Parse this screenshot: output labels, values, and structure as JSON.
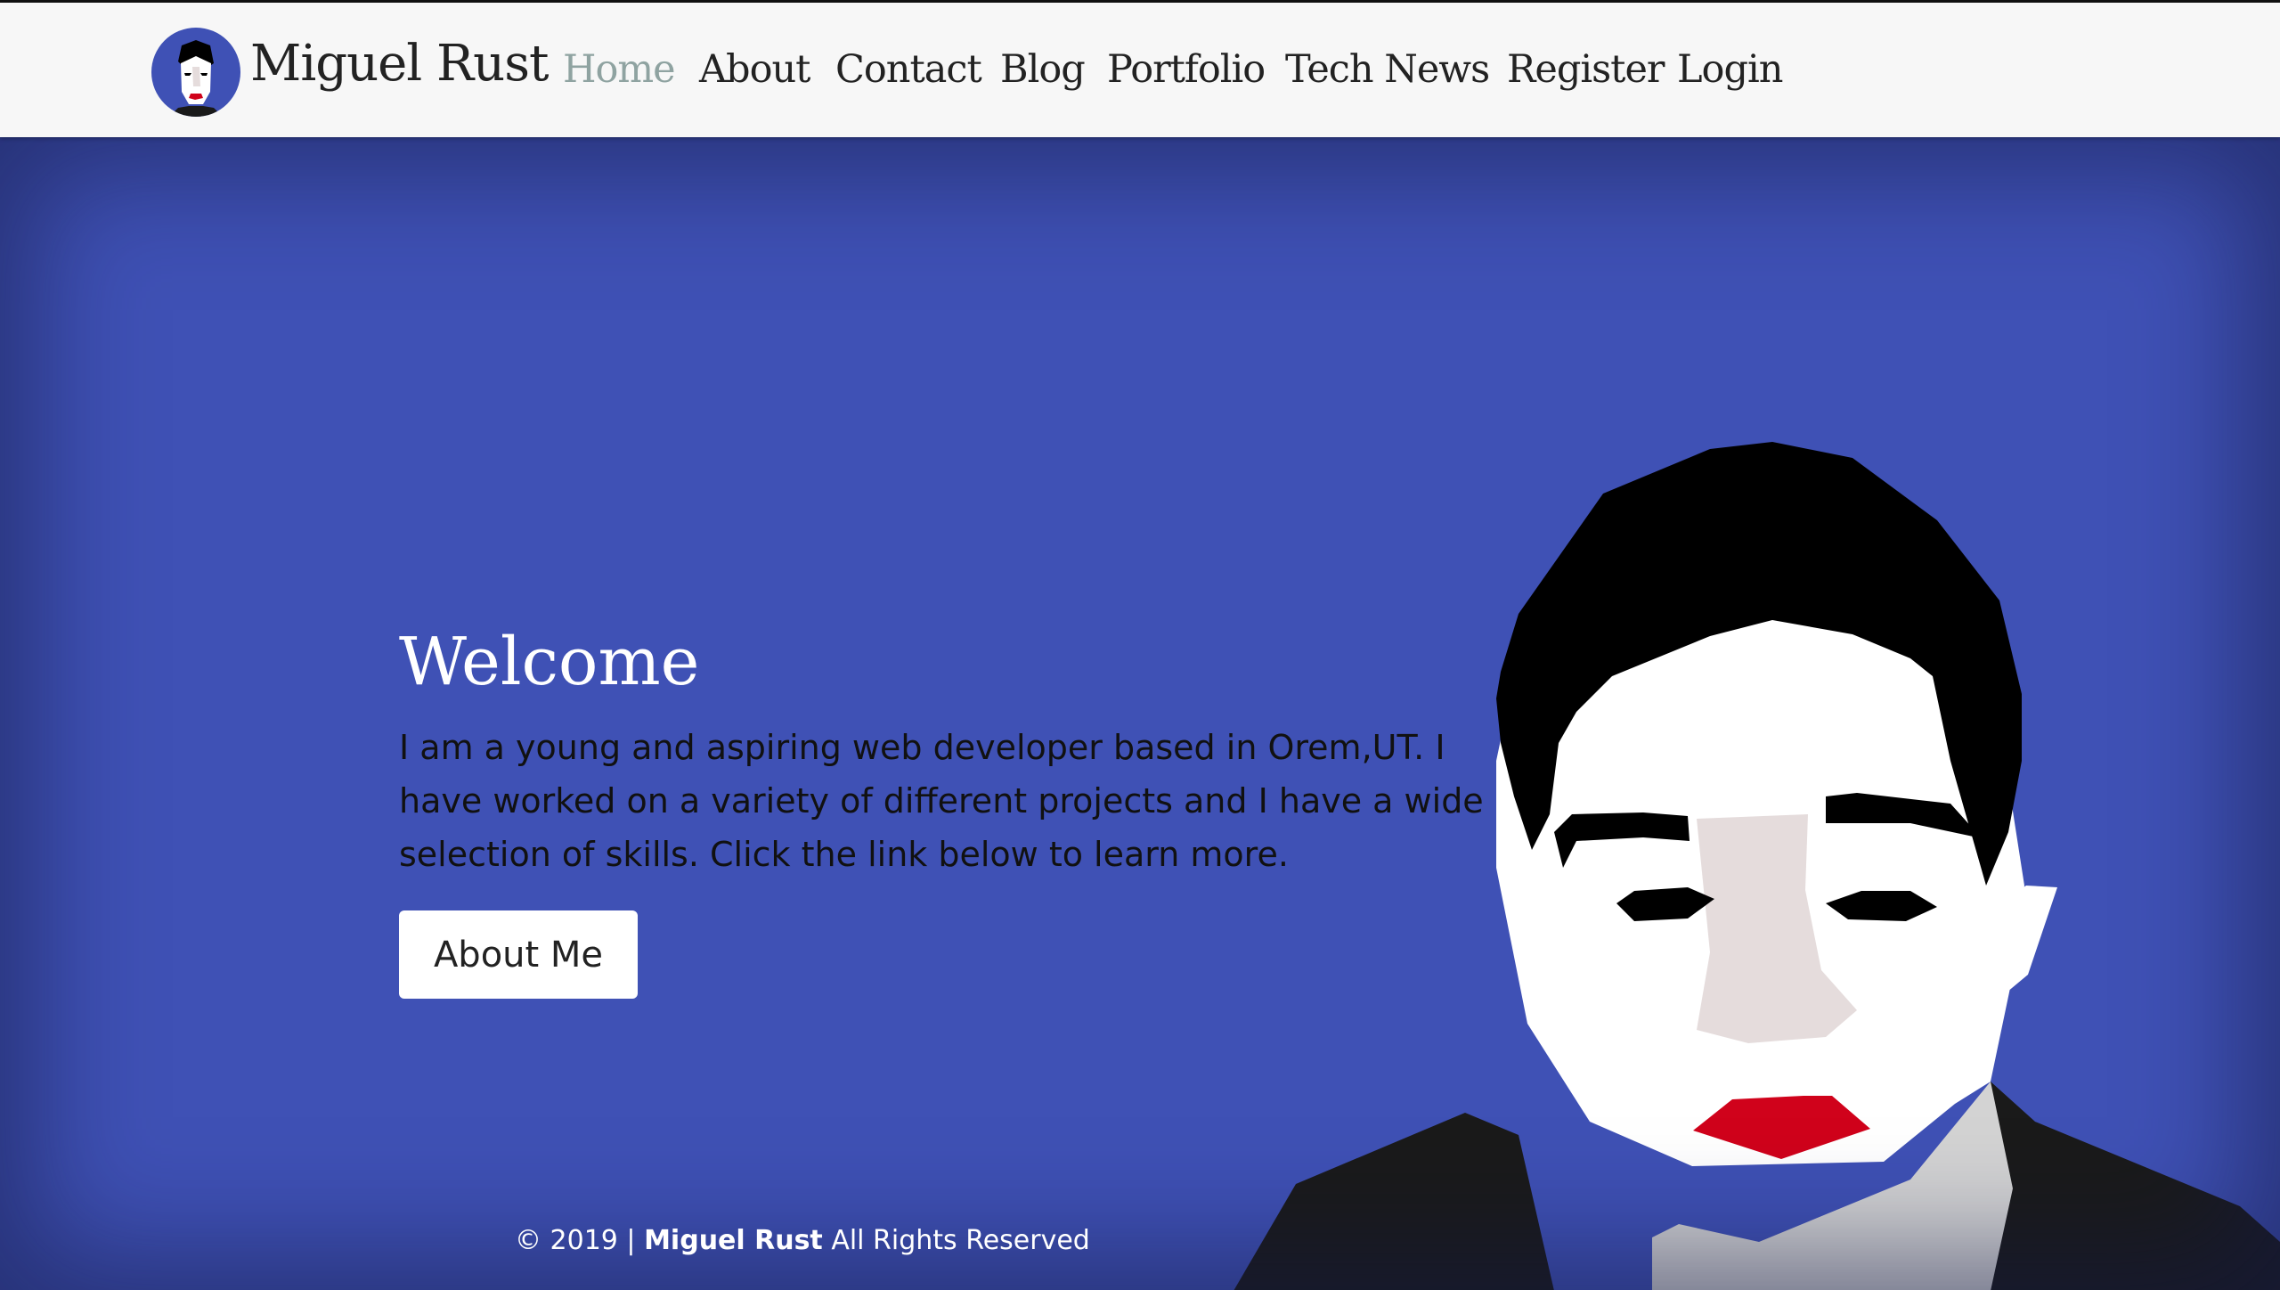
{
  "brand": {
    "name": "Miguel Rust",
    "avatar_icon": "face-portrait-icon"
  },
  "nav": {
    "items": [
      {
        "label": "Home",
        "active": true
      },
      {
        "label": "About"
      },
      {
        "label": "Contact"
      },
      {
        "label": "Blog"
      },
      {
        "label": "Portfolio"
      },
      {
        "label": "Tech News"
      },
      {
        "label": "Register"
      },
      {
        "label": "Login"
      }
    ]
  },
  "hero": {
    "title": "Welcome",
    "text": "I am a young and aspiring web developer based in Orem,UT. I have worked on a variety of different projects and I have a wide selection of skills. Click the link below to learn more.",
    "button_label": "About Me",
    "illustration": "low-poly-face-portrait"
  },
  "footer": {
    "prefix": "© 2019 | ",
    "name": "Miguel Rust",
    "suffix": " All Rights Reserved"
  },
  "colors": {
    "background": "#3f51b5",
    "navbar": "#f7f7f7",
    "nav_active": "#8fa3a1",
    "lips": "#d0021b",
    "hair": "#000000",
    "skin": "#ffffff",
    "nose": "#e5dcdc",
    "jacket": "#1a1a1a",
    "shirt": "#d3d3d3"
  }
}
